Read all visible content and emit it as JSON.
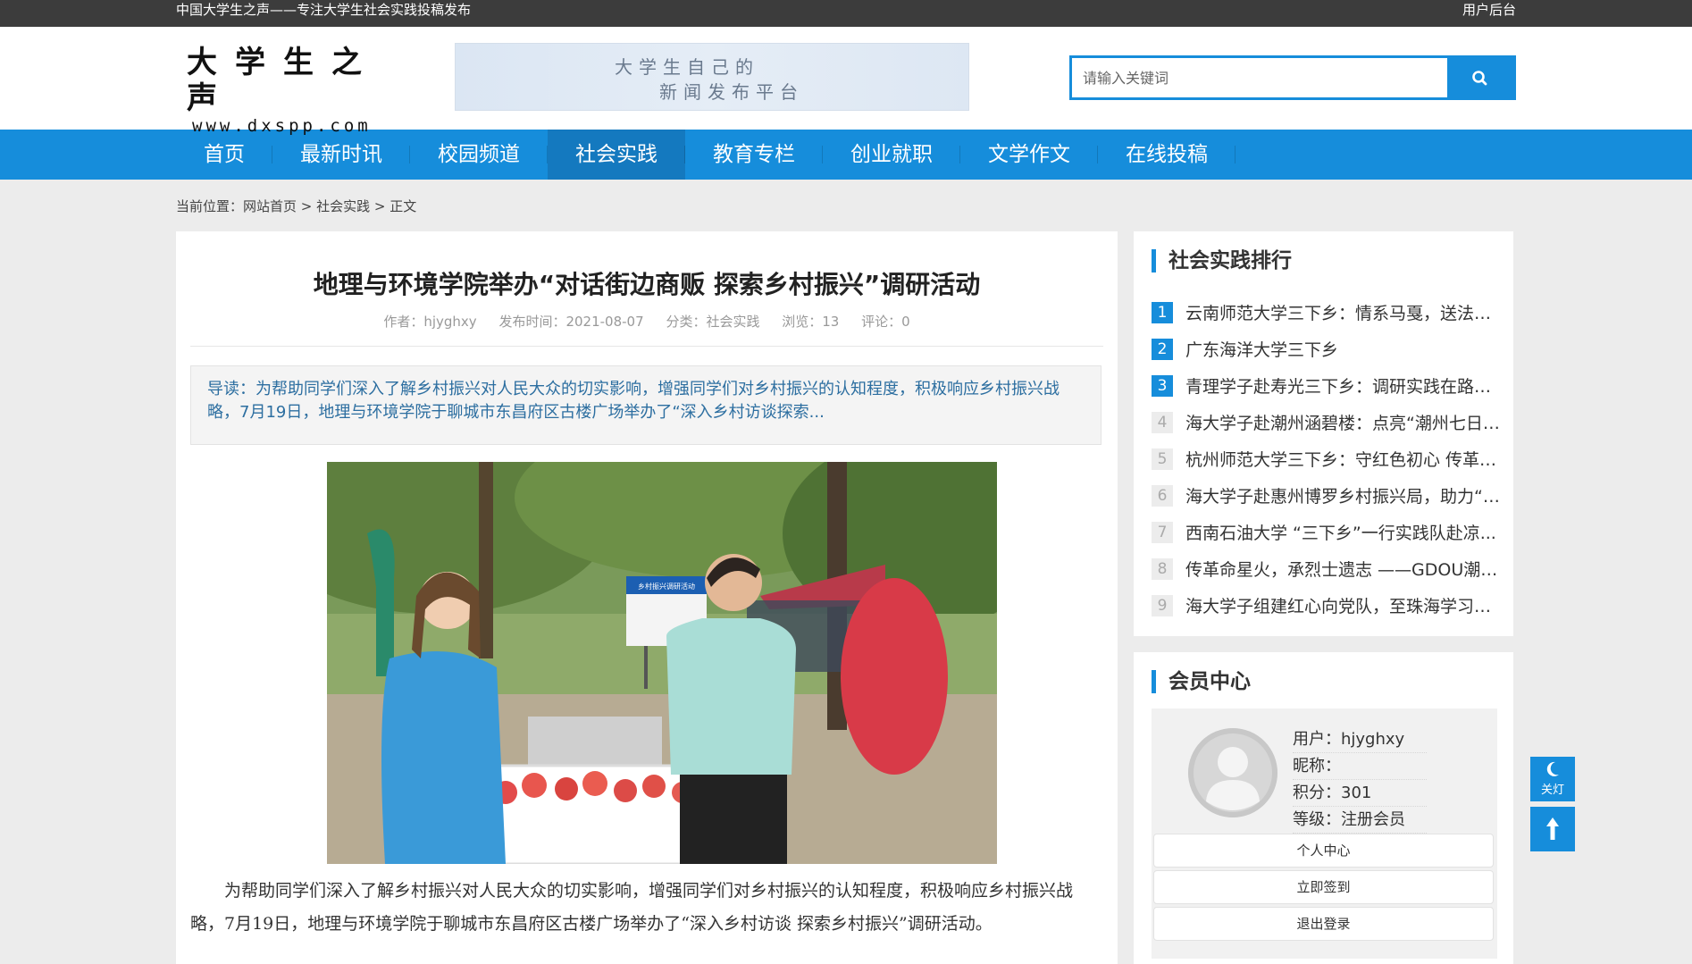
{
  "topbar": {
    "tagline": "中国大学生之声——专注大学生社会实践投稿发布",
    "user_link": "用户后台"
  },
  "logo": {
    "cn": "大学生之声",
    "en": "www.dxspp.com"
  },
  "banner": {
    "line1": "大学生自己的",
    "line2": "新闻发布平台"
  },
  "search": {
    "placeholder": "请输入关键词",
    "icon": "search-icon"
  },
  "nav": {
    "items": [
      "首页",
      "最新时讯",
      "校园频道",
      "社会实践",
      "教育专栏",
      "创业就职",
      "文学作文",
      "在线投稿"
    ],
    "active": "社会实践"
  },
  "breadcrumb": {
    "prefix": "当前位置：",
    "home": "网站首页",
    "sep1": " > ",
    "section": "社会实践",
    "sep2": " > ",
    "current": "正文"
  },
  "article": {
    "title": "地理与环境学院举办“对话街边商贩 探索乡村振兴”调研活动",
    "author": "作者：hjyghxy",
    "date": "发布时间：2021-08-07",
    "category": "分类：社会实践",
    "views": "浏览：13",
    "comments": "评论：0",
    "lead": "导读：为帮助同学们深入了解乡村振兴对人民大众的切实影响，增强同学们对乡村振兴的认知程度，积极响应乡村振兴战略，7月19日，地理与环境学院于聊城市东昌府区古楼广场举办了“深入乡村访谈探索...",
    "paragraph": "为帮助同学们深入了解乡村振兴对人民大众的切实影响，增强同学们对乡村振兴的认知程度，积极响应乡村振兴战略，7月19日，地理与环境学院于聊城市东昌府区古楼广场举办了“深入乡村访谈 探索乡村振兴”调研活动。",
    "photo_sign": "乡村振兴调研活动"
  },
  "ranking": {
    "title": "社会实践排行",
    "items": [
      {
        "num": "1",
        "text": "云南师范大学三下乡：情系马戛，送法下乡"
      },
      {
        "num": "2",
        "text": "广东海洋大学三下乡"
      },
      {
        "num": "3",
        "text": "青理学子赴寿光三下乡：调研实践在路上，..."
      },
      {
        "num": "4",
        "text": "海大学子赴潮州涵碧楼：点亮“潮州七日红..."
      },
      {
        "num": "5",
        "text": "杭州师范大学三下乡：守红色初心 传革命..."
      },
      {
        "num": "6",
        "text": "海大学子赴惠州博罗乡村振兴局，助力“鹅..."
      },
      {
        "num": "7",
        "text": "西南石油大学 “三下乡”一行实践队赴凉..."
      },
      {
        "num": "8",
        "text": "传革命星火，承烈士遗志 ——GDOU潮州..."
      },
      {
        "num": "9",
        "text": "海大学子组建红心向党队，至珠海学习百年..."
      }
    ]
  },
  "member": {
    "title": "会员中心",
    "user": "用户：hjyghxy",
    "nickname": "昵称：",
    "points": "积分：301",
    "level": "等级：注册会员",
    "buttons": {
      "center": "个人中心",
      "signin": "立即签到",
      "logout": "退出登录"
    }
  },
  "float": {
    "light_label": "关灯"
  },
  "colors": {
    "brand": "#168ddb",
    "nav_active": "#1479bf",
    "topbar": "#3c3c3c",
    "lead_text": "#2c6ea0"
  }
}
